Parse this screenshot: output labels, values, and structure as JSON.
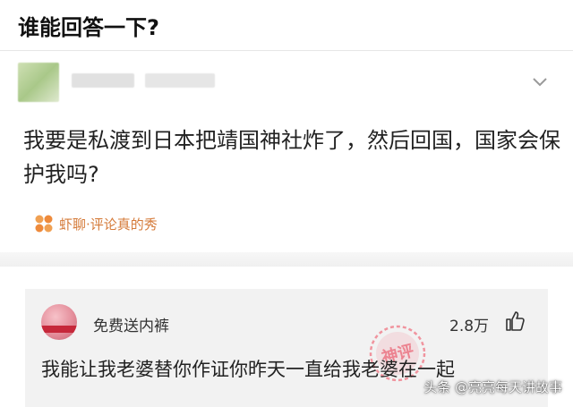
{
  "page": {
    "title": "谁能回答一下?"
  },
  "question": {
    "text": "我要是私渡到日本把靖国神社炸了，然后回国，国家会保护我吗?",
    "source_label": "虾聊·评论真的秀"
  },
  "comment": {
    "username": "免费送内裤",
    "likes": "2.8万",
    "text": "我能让我老婆替你作证你昨天一直给我老婆在一起",
    "stamp_text": "神评"
  },
  "watermark": "头条 @亮亮每天讲故事",
  "icons": {
    "expand": "chevron-down-icon",
    "like": "thumbs-up-icon",
    "source": "xialiao-logo-icon"
  },
  "colors": {
    "source_accent": "#d57b3a",
    "stamp": "#f08a96",
    "comment_bg": "#f2f2f2"
  }
}
